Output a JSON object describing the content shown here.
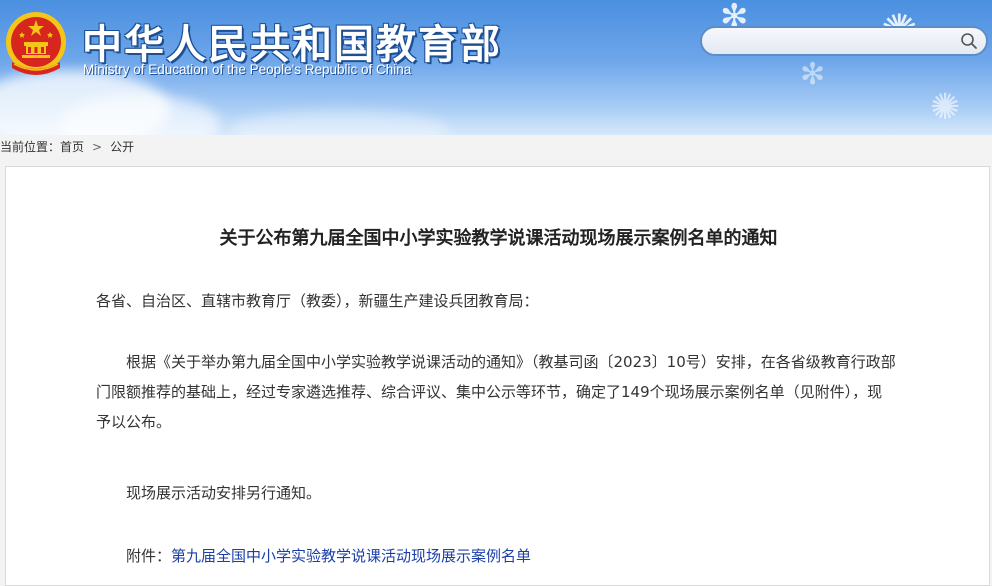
{
  "header": {
    "title": "中华人民共和国教育部",
    "subtitle": "Ministry of Education of the People's Republic of China",
    "search": {
      "placeholder": "",
      "value": ""
    }
  },
  "breadcrumb": {
    "prefix": "当前位置：",
    "items": [
      "首页",
      "公开"
    ],
    "separator": ">"
  },
  "article": {
    "title": "关于公布第九届全国中小学实验教学说课活动现场展示案例名单的通知",
    "salutation": "各省、自治区、直辖市教育厅（教委），新疆生产建设兵团教育局：",
    "body": "根据《关于举办第九届全国中小学实验教学说课活动的通知》（教基司函〔2023〕10号）安排，在各省级教育行政部门限额推荐的基础上，经过专家遴选推荐、综合评议、集中公示等环节，确定了149个现场展示案例名单（见附件），现予以公布。",
    "note": "现场展示活动安排另行通知。",
    "attachment_label": "附件：",
    "attachment_link": "第九届全国中小学实验教学说课活动现场展示案例名单"
  },
  "colors": {
    "header_blue": "#4a8fe0",
    "link": "#1a3fa8",
    "emblem_red": "#d7261e",
    "emblem_gold": "#f5c518"
  }
}
